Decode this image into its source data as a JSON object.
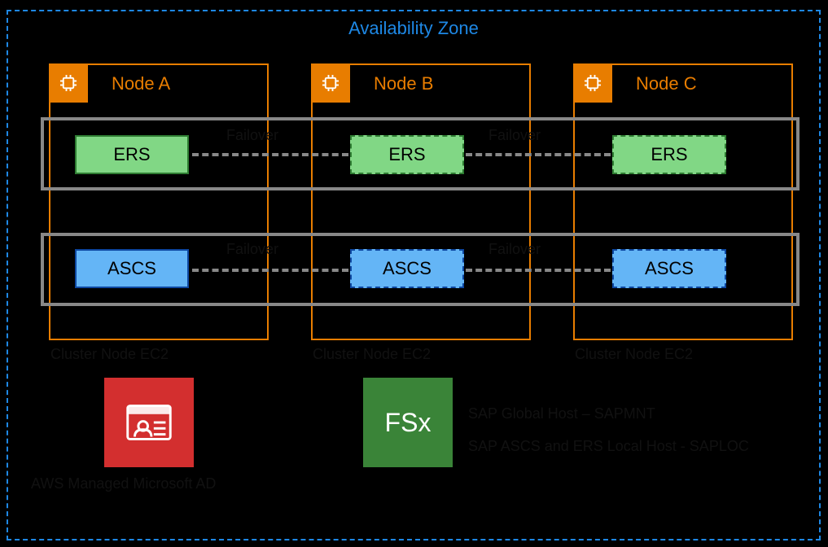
{
  "az": {
    "title": "Availability Zone"
  },
  "nodes": {
    "a": {
      "label": "Node A",
      "footer": "Cluster Node EC2"
    },
    "b": {
      "label": "Node B",
      "footer": "Cluster Node EC2"
    },
    "c": {
      "label": "Node C",
      "footer": "Cluster Node EC2"
    }
  },
  "services": {
    "ers": "ERS",
    "ascs": "ASCS"
  },
  "failover": "Failover",
  "amad": {
    "label": "AWS Managed Microsoft AD"
  },
  "fsx": {
    "icon_text": "FSx",
    "line1": "SAP Global Host – SAPMNT",
    "line2": "SAP ASCS and ERS Local Host - SAPLOC"
  }
}
